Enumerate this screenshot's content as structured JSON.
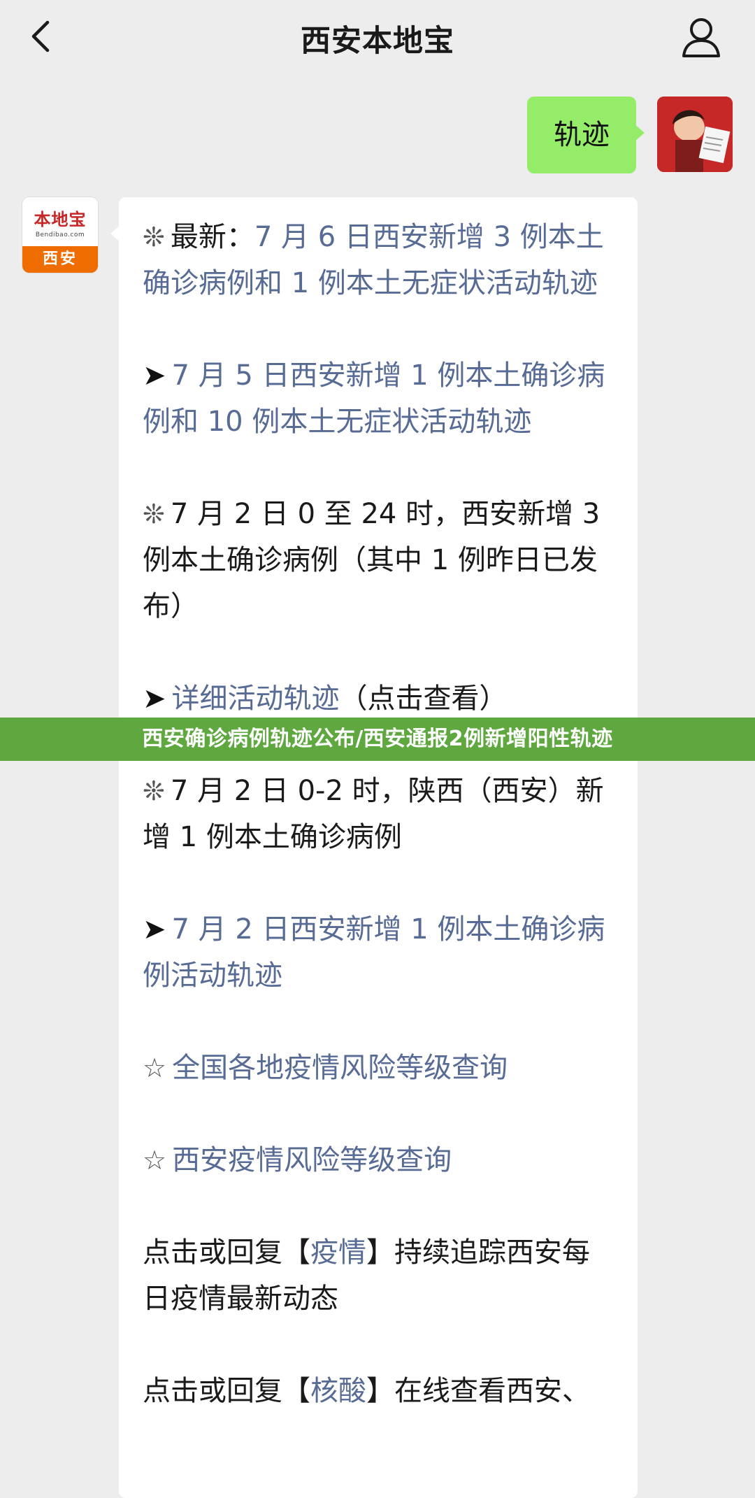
{
  "header": {
    "title": "西安本地宝"
  },
  "user_message": {
    "text": "轨迹"
  },
  "bot": {
    "avatar": {
      "brand_top": "本地宝",
      "brand_domain": "Bendibao.com",
      "brand_city": "西安"
    },
    "items": [
      {
        "glyph": "❊",
        "lead": "最新：",
        "link": "7 月 6 日西安新增 3 例本土确诊病例和 1 例本土无症状活动轨迹",
        "plain": ""
      },
      {
        "glyph": "➤",
        "lead": "",
        "link": "7 月 5 日西安新增 1 例本土确诊病例和 10 例本土无症状活动轨迹",
        "plain": ""
      },
      {
        "glyph": "❊",
        "lead": "7 月 2 日 0 至 24 时，西安新增 3 例本土确诊病例（其中 1 例昨日已发布）",
        "link": "",
        "plain": ""
      },
      {
        "glyph": "➤",
        "lead": "",
        "link": "详细活动轨迹",
        "plain": "（点击查看）"
      },
      {
        "glyph": "❊",
        "lead": "7 月 2 日 0-2 时，陕西（西安）新增 1 例本土确诊病例",
        "link": "",
        "plain": ""
      },
      {
        "glyph": "➤",
        "lead": "",
        "link": "7 月 2 日西安新增 1 例本土确诊病例活动轨迹",
        "plain": ""
      },
      {
        "glyph": "☆",
        "lead": "",
        "link": "全国各地疫情风险等级查询",
        "plain": ""
      },
      {
        "glyph": "☆",
        "lead": "",
        "link": "西安疫情风险等级查询",
        "plain": ""
      }
    ],
    "reply_1": {
      "pre": "点击或回复【",
      "link": "疫情",
      "post": "】持续追踪西安每日疫情最新动态"
    },
    "reply_2": {
      "pre": "点击或回复【",
      "link": "核酸",
      "post": "】在线查看西安、"
    }
  },
  "banner": {
    "text": "西安确诊病例轨迹公布/西安通报2例新增阳性轨迹"
  },
  "colors": {
    "background": "#ededed",
    "user_bubble": "#95ec69",
    "link": "#576b95",
    "banner": "#5ea83f"
  }
}
